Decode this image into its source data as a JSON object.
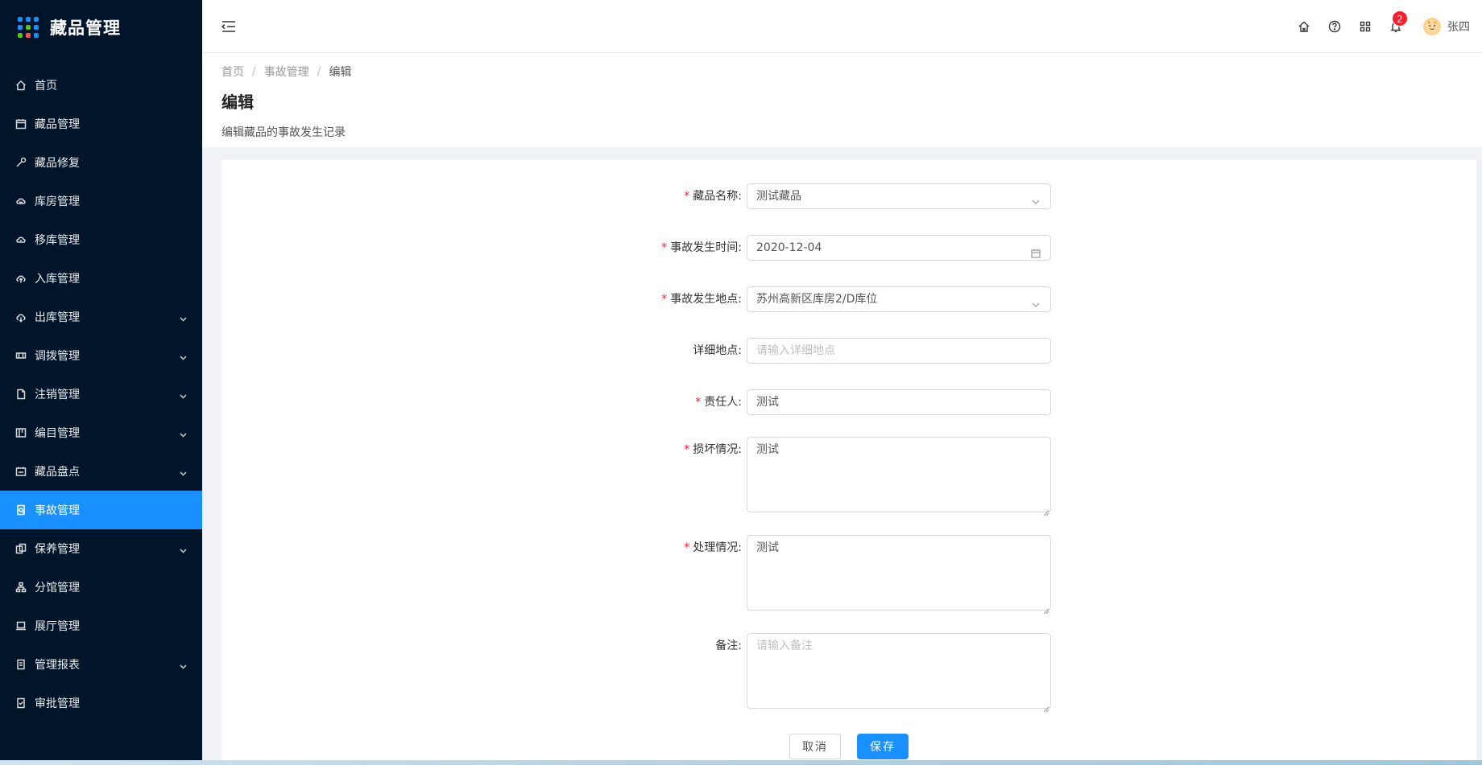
{
  "app": {
    "title": "藏品管理"
  },
  "sidebar": {
    "items": [
      {
        "label": "首页",
        "icon": "home-icon",
        "expandable": false,
        "active": false
      },
      {
        "label": "藏品管理",
        "icon": "calendar-icon",
        "expandable": false,
        "active": false
      },
      {
        "label": "藏品修复",
        "icon": "tool-icon",
        "expandable": false,
        "active": false
      },
      {
        "label": "库房管理",
        "icon": "cloud-server-icon",
        "expandable": false,
        "active": false
      },
      {
        "label": "移库管理",
        "icon": "cloud-sync-icon",
        "expandable": false,
        "active": false
      },
      {
        "label": "入库管理",
        "icon": "cloud-upload-icon",
        "expandable": false,
        "active": false
      },
      {
        "label": "出库管理",
        "icon": "cloud-download-icon",
        "expandable": true,
        "active": false
      },
      {
        "label": "调拨管理",
        "icon": "transfer-icon",
        "expandable": true,
        "active": false
      },
      {
        "label": "注销管理",
        "icon": "file-icon",
        "expandable": true,
        "active": false
      },
      {
        "label": "编目管理",
        "icon": "catalog-icon",
        "expandable": true,
        "active": false
      },
      {
        "label": "藏品盘点",
        "icon": "inventory-icon",
        "expandable": true,
        "active": false
      },
      {
        "label": "事故管理",
        "icon": "accident-icon",
        "expandable": false,
        "active": true
      },
      {
        "label": "保养管理",
        "icon": "maintenance-icon",
        "expandable": true,
        "active": false
      },
      {
        "label": "分馆管理",
        "icon": "branch-icon",
        "expandable": false,
        "active": false
      },
      {
        "label": "展厅管理",
        "icon": "laptop-icon",
        "expandable": false,
        "active": false
      },
      {
        "label": "管理报表",
        "icon": "report-icon",
        "expandable": true,
        "active": false
      },
      {
        "label": "审批管理",
        "icon": "audit-icon",
        "expandable": false,
        "active": false
      }
    ]
  },
  "header": {
    "notification_count": "2",
    "user_name": "张四"
  },
  "breadcrumb": {
    "home": "首页",
    "sep": "/",
    "parent": "事故管理",
    "current": "编辑"
  },
  "page": {
    "title": "编辑",
    "description": "编辑藏品的事故发生记录"
  },
  "form": {
    "collection_name": {
      "label": "藏品名称:",
      "value": "测试藏品",
      "required": true
    },
    "accident_time": {
      "label": "事故发生时间:",
      "value": "2020-12-04",
      "required": true
    },
    "accident_location": {
      "label": "事故发生地点:",
      "value": "苏州高新区库房2/D库位",
      "required": true
    },
    "detail_location": {
      "label": "详细地点:",
      "placeholder": "请输入详细地点",
      "required": false
    },
    "responsible_person": {
      "label": "责任人:",
      "value": "测试",
      "required": true
    },
    "damage": {
      "label": "损坏情况:",
      "value": "测试",
      "required": true
    },
    "handling": {
      "label": "处理情况:",
      "value": "测试",
      "required": true
    },
    "remarks": {
      "label": "备注:",
      "placeholder": "请输入备注",
      "required": false
    }
  },
  "buttons": {
    "cancel": "取消",
    "save": "保存"
  },
  "required_mark": "*",
  "colors": {
    "sidebar_bg": "#001529",
    "primary": "#1890ff",
    "required": "#f5222d",
    "badge": "#f5222d"
  }
}
